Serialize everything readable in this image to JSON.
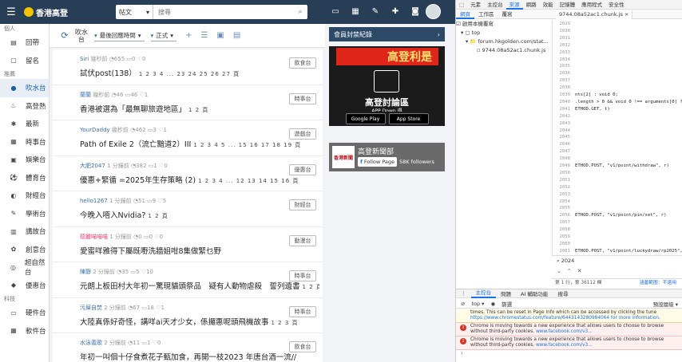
{
  "site": {
    "logo_text": "香港高登",
    "search": {
      "category": "帖文",
      "placeholder": "搜尋"
    },
    "sidebar": {
      "groups": [
        {
          "label": "個人",
          "items": [
            {
              "label": "回帶",
              "icon": "archive-icon"
            },
            {
              "label": "留名",
              "icon": "bookmark-icon"
            }
          ]
        },
        {
          "label": "推薦",
          "items": [
            {
              "label": "吹水台",
              "icon": "water-icon",
              "active": true
            },
            {
              "label": "高登熱",
              "icon": "fire-icon"
            },
            {
              "label": "最新",
              "icon": "new-icon"
            },
            {
              "label": "時事台",
              "icon": "news-icon"
            },
            {
              "label": "娛樂台",
              "icon": "entertainment-icon"
            },
            {
              "label": "體育台",
              "icon": "sports-icon"
            },
            {
              "label": "財經台",
              "icon": "finance-icon"
            },
            {
              "label": "學術台",
              "icon": "academic-icon"
            },
            {
              "label": "講故台",
              "icon": "story-icon"
            },
            {
              "label": "創意台",
              "icon": "creative-icon"
            },
            {
              "label": "超自然台",
              "icon": "supernatural-icon"
            },
            {
              "label": "優惠台",
              "icon": "deal-icon"
            }
          ]
        },
        {
          "label": "科技",
          "items": [
            {
              "label": "硬件台",
              "icon": "hardware-icon"
            },
            {
              "label": "軟件台",
              "icon": "software-icon"
            }
          ]
        }
      ]
    },
    "filter": {
      "channel": "吹水台",
      "sort": "最後回應時間",
      "mode": "正式"
    },
    "threads": [
      {
        "user": "Siri",
        "time": "幾秒前",
        "views": "655",
        "replies": "0",
        "likes": "0",
        "title": "試伏post(138）",
        "pages": "1 2 3 4 ... 23 24 25 26 27 頁",
        "tag": "飲食台",
        "female": false
      },
      {
        "user": "蘭蘭",
        "time": "幾秒前",
        "views": "46",
        "replies": "46",
        "likes": "1",
        "title": "香港被選為「最無聊旅遊地區」",
        "pages": "1 2 頁",
        "tag": "時事台",
        "female": false
      },
      {
        "user": "YourDaddy",
        "time": "幾秒前",
        "views": "462",
        "replies": "3",
        "likes": "1",
        "title": "Path of Exile 2（流亡黯道2）III",
        "pages": "1 2 3 4 5 ... 15 16 17 18 19 頁",
        "tag": "遊戲台",
        "female": false
      },
      {
        "user": "大肥2047",
        "time": "1 分鐘前",
        "views": "382",
        "replies": "1",
        "likes": "0",
        "title": "優惠+緊循 =2025年生存策略 (2)",
        "pages": "1 2 3 4 ... 12 13 14 15 16 頁",
        "tag": "優惠台",
        "female": false
      },
      {
        "user": "hello1267",
        "time": "1 分鐘前",
        "views": "51",
        "replies": "9",
        "likes": "5",
        "title": "今晚入唔入Nvidia?",
        "pages": "1 2 頁",
        "tag": "財經台",
        "female": false
      },
      {
        "user": "德麗喵喵喵",
        "time": "1 分鐘前",
        "views": "0",
        "replies": "0",
        "likes": "0",
        "title": "愛蜜咩雅得下屬既嘢洗牆姐咁8集做緊乜野",
        "pages": "",
        "tag": "動漫台",
        "female": true
      },
      {
        "user": "陳靜",
        "time": "2 分鐘前",
        "views": "35",
        "replies": "5",
        "likes": "10",
        "title": "元朗上板田村大年初一驚現貓頭祭品　疑有人動物虐殺　誓列遺書",
        "pages": "1 2 頁",
        "tag": "時事台",
        "female": false
      },
      {
        "user": "污屎自焚",
        "time": "2 分鐘前",
        "views": "67",
        "replies": "18",
        "likes": "1",
        "title": "大陸真係好奇怪，講咩ai天才少女，係攞惠呢頭飛機故事",
        "pages": "1 2 3 頁",
        "tag": "時事台",
        "female": false
      },
      {
        "user": "水泳義歌",
        "time": "2 分鐘前",
        "views": "11",
        "replies": "1",
        "likes": "0",
        "title": "年初一叫個十仔食煮花子甄加食，再開一枝2023 年唐台酒一流//",
        "pages": "",
        "tag": "飲食台",
        "female": false
      }
    ],
    "right": {
      "header": "會員封禁紀錄",
      "ad": {
        "banner": "高登利是",
        "title": "高登討論區",
        "subtitle": "APP Down 得",
        "google": "Google Play",
        "apple": "App Store"
      },
      "news": {
        "logo": "香港新聞",
        "title": "高登新聞部",
        "follow": "Follow Page",
        "followers": "58K followers"
      }
    }
  },
  "devtools": {
    "tabs": [
      "元素",
      "主控台",
      "來源",
      "網路",
      "效能",
      "記憶體",
      "應用程式",
      "安全性"
    ],
    "active_tab": "來源",
    "subtabs": [
      "網頁",
      "工作區",
      "覆寫"
    ],
    "active_subtab": "網頁",
    "file_tab": "9744.08a52ac1.chunk.js",
    "tree": [
      "top",
      "forum.hkgolden.com/stat...",
      "9744.08a52ac1.chunk.js"
    ],
    "overrides_checkbox": "啟用本機覆寫",
    "code_lines": [
      {
        "n": "2029",
        "t": ""
      },
      {
        "n": "2030",
        "t": ""
      },
      {
        "n": "2031",
        "t": ""
      },
      {
        "n": "2032",
        "t": ""
      },
      {
        "n": "2033",
        "t": ""
      },
      {
        "n": "2034",
        "t": ""
      },
      {
        "n": "2035",
        "t": ""
      },
      {
        "n": "2036",
        "t": ""
      },
      {
        "n": "2037",
        "t": ""
      },
      {
        "n": "2038",
        "t": ""
      },
      {
        "n": "2039",
        "t": "nts[2] : void 0;"
      },
      {
        "n": "2040",
        "t": ".length > 0 && void 0 !== arguments[0] ?"
      },
      {
        "n": "2041",
        "t": "ETHOD.GET, t)"
      },
      {
        "n": "2042",
        "t": ""
      },
      {
        "n": "2043",
        "t": ""
      },
      {
        "n": "2044",
        "t": ""
      },
      {
        "n": "2045",
        "t": ""
      },
      {
        "n": "2046",
        "t": ""
      },
      {
        "n": "2047",
        "t": ""
      },
      {
        "n": "2048",
        "t": ""
      },
      {
        "n": "2049",
        "t": "ETHOD.POST, \"v1/point/withdraw\", r)"
      },
      {
        "n": "2050",
        "t": ""
      },
      {
        "n": "2051",
        "t": ""
      },
      {
        "n": "2052",
        "t": ""
      },
      {
        "n": "2053",
        "t": ""
      },
      {
        "n": "2054",
        "t": ""
      },
      {
        "n": "2055",
        "t": ""
      },
      {
        "n": "2056",
        "t": "ETHOD.POST, \"v1/point/pin/set\", r)"
      },
      {
        "n": "2057",
        "t": ""
      },
      {
        "n": "2058",
        "t": ""
      },
      {
        "n": "2059",
        "t": ""
      },
      {
        "n": "2060",
        "t": ""
      },
      {
        "n": "2061",
        "t": "ETHOD.POST, \"v1/point/luckydraw/rp2025\","
      }
    ],
    "search_query": "2024",
    "status": {
      "position": "第 1 行，第 36112 欄",
      "link": "涵蓋範圍：不適用"
    },
    "console_tabs": [
      "主控台",
      "問題",
      "AI 輔助功能",
      "搜尋"
    ],
    "console_toolbar": {
      "context": "top",
      "filter": "篩選",
      "levels": "預設層級"
    },
    "messages": [
      {
        "kind": "warn",
        "text": "times. This can be reset in Page Info which can be accessed by clicking the tune",
        "link": "https://www.chromestatus.com/feature/6443143280984064 for more information."
      },
      {
        "kind": "err",
        "count": "2",
        "text": "Chrome is moving towards a new experience that allows users to choose to browse without third-party cookies.",
        "link": "www.facebook.com/v3..."
      },
      {
        "kind": "err",
        "count": "2",
        "text": "Chrome is moving towards a new experience that allows users to choose to browse without third-party cookies.",
        "link": "www.facebook.com/v3..."
      }
    ]
  }
}
